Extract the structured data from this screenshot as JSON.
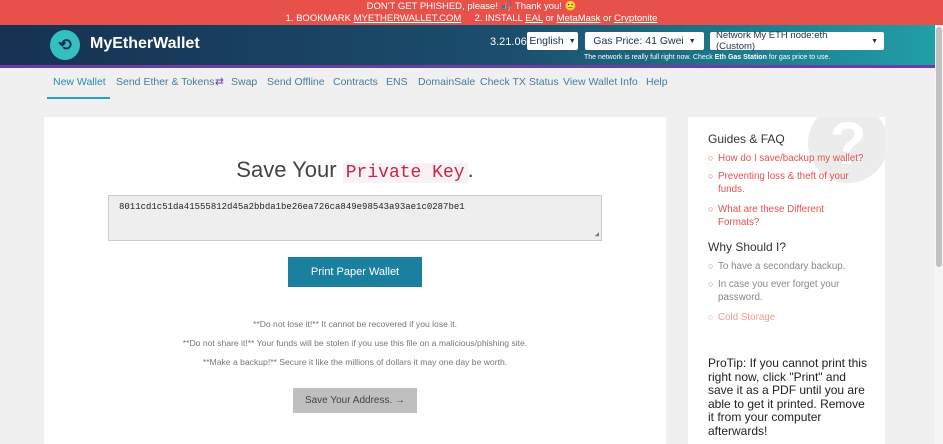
{
  "banner": {
    "line1": "DON'T GET PHISHED, please! 🎣 Thank you! 🙂",
    "line2_prefix": "1. BOOKMARK",
    "bookmark_link": "MYETHERWALLET.COM",
    "line2_mid": "2. INSTALL",
    "eal_link": "EAL",
    "or1": "or",
    "metamask_link": "MetaMask",
    "or2": "or",
    "cryptonite_link": "Cryptonite"
  },
  "header": {
    "brand": "MyEtherWallet",
    "version": "3.21.06",
    "language": "English",
    "gas_price": "Gas Price: 41 Gwei",
    "network": "Network My ETH node:eth (Custom)",
    "network_note_prefix": "The network is really full right now. Check",
    "network_note_link": "Eth Gas Station",
    "network_note_suffix": "for gas price to use."
  },
  "nav": {
    "items": [
      {
        "label": "New Wallet"
      },
      {
        "label": "Send Ether & Tokens"
      },
      {
        "label": "Swap"
      },
      {
        "label": "Send Offline"
      },
      {
        "label": "Contracts"
      },
      {
        "label": "ENS"
      },
      {
        "label": "DomainSale"
      },
      {
        "label": "Check TX Status"
      },
      {
        "label": "View Wallet Info"
      },
      {
        "label": "Help"
      }
    ]
  },
  "main": {
    "title_prefix": "Save Your",
    "title_code": "Private Key",
    "title_suffix": ".",
    "private_key": "8011cd1c51da41555812d45a2bbda1be26ea726ca849e98543a93ae1c0287be1",
    "print_button": "Print Paper Wallet",
    "warnings": [
      "**Do not lose it!** It cannot be recovered if you lose it.",
      "**Do not share it!** Your funds will be stolen if you use this file on a malicious/phishing site.",
      "**Make a backup!** Secure it like the millions of dollars it may one day be worth."
    ],
    "next_button": "Save Your Address. →"
  },
  "sidebar": {
    "guides_title": "Guides & FAQ",
    "guides": [
      "How do I save/backup my wallet?",
      "Preventing loss & theft of your funds.",
      "What are these Different Formats?"
    ],
    "why_title": "Why Should I?",
    "why_items": [
      "To have a secondary backup.",
      "In case you ever forget your password."
    ],
    "cold_storage": "Cold Storage",
    "protip": "ProTip: If you cannot print this right now, click \"Print\" and save it as a PDF until you are able to get it printed. Remove it from your computer afterwards!"
  },
  "colors": {
    "banner": "#e8514a",
    "header_dark": "#163151",
    "header_teal": "#20a1a8",
    "primary_button": "#1b7fa0",
    "link_red": "#e8514a",
    "nav_link": "#4a7b9a"
  }
}
